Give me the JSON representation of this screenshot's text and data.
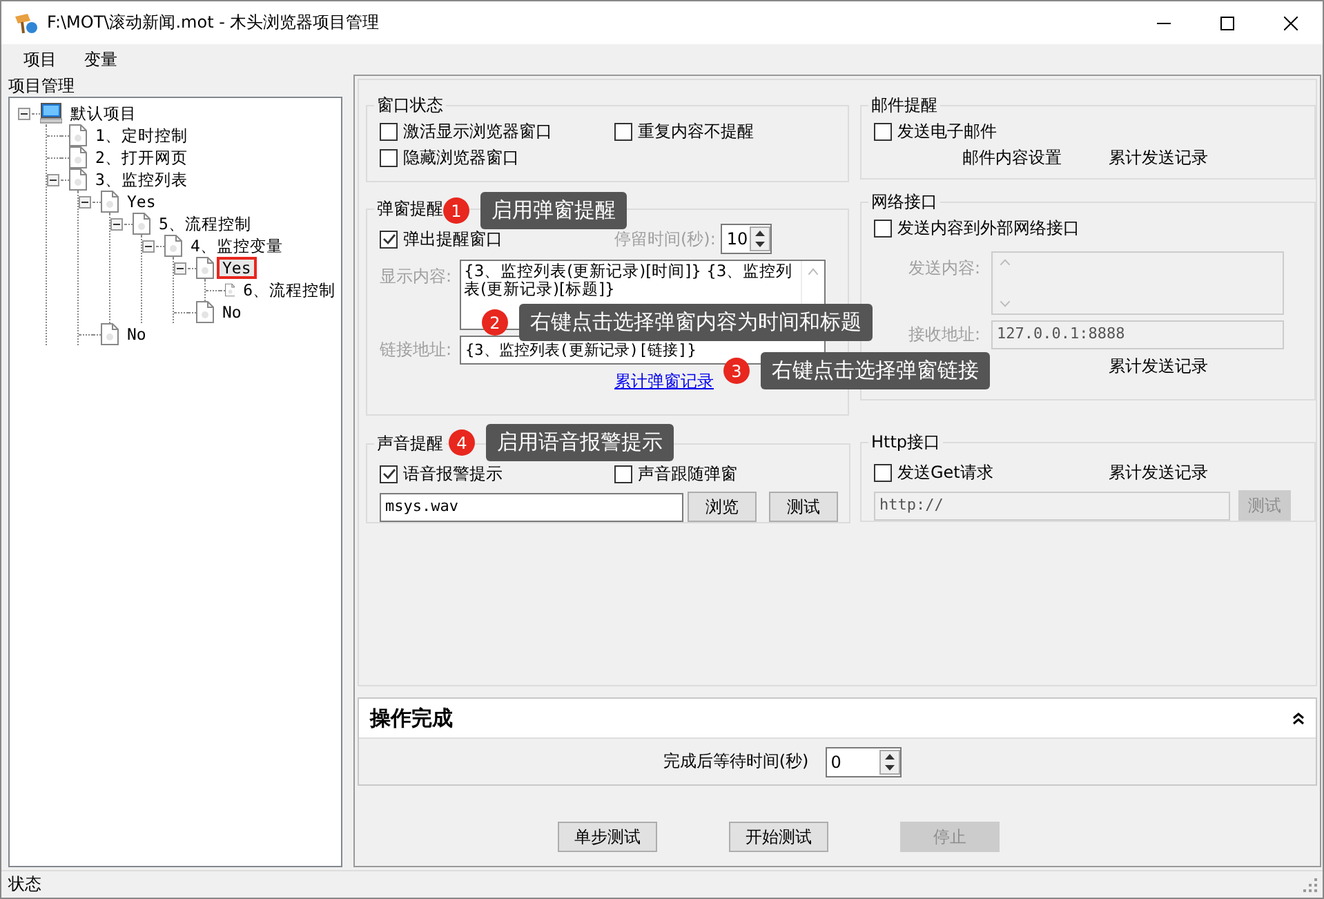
{
  "window": {
    "title": "F:\\MOT\\滚动新闻.mot  - 木头浏览器项目管理"
  },
  "menu": [
    {
      "label": "项目"
    },
    {
      "label": "变量"
    }
  ],
  "tree_panel": {
    "title": "项目管理",
    "items": [
      {
        "label": "默认项目",
        "kind": "root",
        "expanded": true,
        "selected": false,
        "marked": false,
        "children": [
          {
            "label": "1、定时控制",
            "kind": "doc",
            "selected": false,
            "marked": false
          },
          {
            "label": "2、打开网页",
            "kind": "doc",
            "selected": false,
            "marked": false
          },
          {
            "label": "3、监控列表",
            "kind": "doc",
            "expanded": true,
            "selected": false,
            "marked": false,
            "children": [
              {
                "label": "Yes",
                "kind": "doc",
                "expanded": true,
                "selected": false,
                "marked": false,
                "children": [
                  {
                    "label": "5、流程控制",
                    "kind": "doc",
                    "expanded": true,
                    "selected": false,
                    "marked": false,
                    "children": [
                      {
                        "label": "4、监控变量",
                        "kind": "doc",
                        "expanded": true,
                        "selected": false,
                        "marked": false,
                        "children": [
                          {
                            "label": "Yes",
                            "kind": "doc",
                            "expanded": true,
                            "selected": true,
                            "marked": true,
                            "children": [
                              {
                                "label": "6、流程控制",
                                "kind": "doc",
                                "selected": false,
                                "marked": false
                              }
                            ]
                          },
                          {
                            "label": "No",
                            "kind": "doc",
                            "selected": false,
                            "marked": false
                          }
                        ]
                      }
                    ]
                  }
                ]
              },
              {
                "label": "No",
                "kind": "doc",
                "selected": false,
                "marked": false
              }
            ]
          }
        ]
      }
    ]
  },
  "window_state": {
    "title": "窗口状态",
    "options": [
      {
        "label": "激活显示浏览器窗口",
        "checked": false
      },
      {
        "label": "重复内容不提醒",
        "checked": false
      },
      {
        "label": "隐藏浏览器窗口",
        "checked": false
      }
    ]
  },
  "popup": {
    "title": "弹窗提醒",
    "show": {
      "label": "弹出提醒窗口",
      "checked": true
    },
    "stay": {
      "label": "停留时间(秒):",
      "value": "10",
      "disabled": true
    },
    "content": {
      "label": "显示内容:",
      "value": "{3、监控列表(更新记录)[时间]}    {3、监控列表(更新记录)[标题]}",
      "disabled": true
    },
    "link": {
      "label": "链接地址:",
      "value": "{3、监控列表(更新记录)[链接]}",
      "disabled": true
    },
    "history": "累计弹窗记录"
  },
  "sound": {
    "title": "声音提醒",
    "options": [
      {
        "label": "语音报警提示",
        "checked": true
      },
      {
        "label": "声音跟随弹窗",
        "checked": false
      }
    ],
    "file": "msys.wav",
    "buttons": [
      {
        "label": "浏览",
        "disabled": false
      },
      {
        "label": "测试",
        "disabled": false
      }
    ]
  },
  "mail": {
    "title": "邮件提醒",
    "send": {
      "label": "发送电子邮件",
      "checked": false
    },
    "links": [
      "邮件内容设置",
      "累计发送记录"
    ]
  },
  "network": {
    "title": "网络接口",
    "send": {
      "label": "发送内容到外部网络接口",
      "checked": false
    },
    "content": {
      "label": "发送内容:",
      "disabled": true
    },
    "address": {
      "label": "接收地址:",
      "value": "127.0.0.1:8888",
      "disabled": true
    },
    "history": "累计发送记录"
  },
  "http": {
    "title": "Http接口",
    "send": {
      "label": "发送Get请求",
      "checked": false
    },
    "history": "累计发送记录",
    "url": {
      "value": "http://",
      "disabled": true
    },
    "test": {
      "label": "测试",
      "disabled": true
    }
  },
  "completion": {
    "title": "操作完成",
    "expanded": true,
    "wait_label": "完成后等待时间(秒)",
    "wait_value": "0"
  },
  "buttons": [
    {
      "label": "单步测试",
      "disabled": false
    },
    {
      "label": "开始测试",
      "disabled": false
    },
    {
      "label": "停止",
      "disabled": true
    }
  ],
  "callouts": [
    {
      "number": "1",
      "text": "启用弹窗提醒"
    },
    {
      "number": "2",
      "text": "右键点击选择弹窗内容为时间和标题"
    },
    {
      "number": "3",
      "text": "右键点击选择弹窗链接"
    },
    {
      "number": "4",
      "text": "启用语音报警提示"
    }
  ],
  "status_bar": {
    "text": "状态"
  }
}
